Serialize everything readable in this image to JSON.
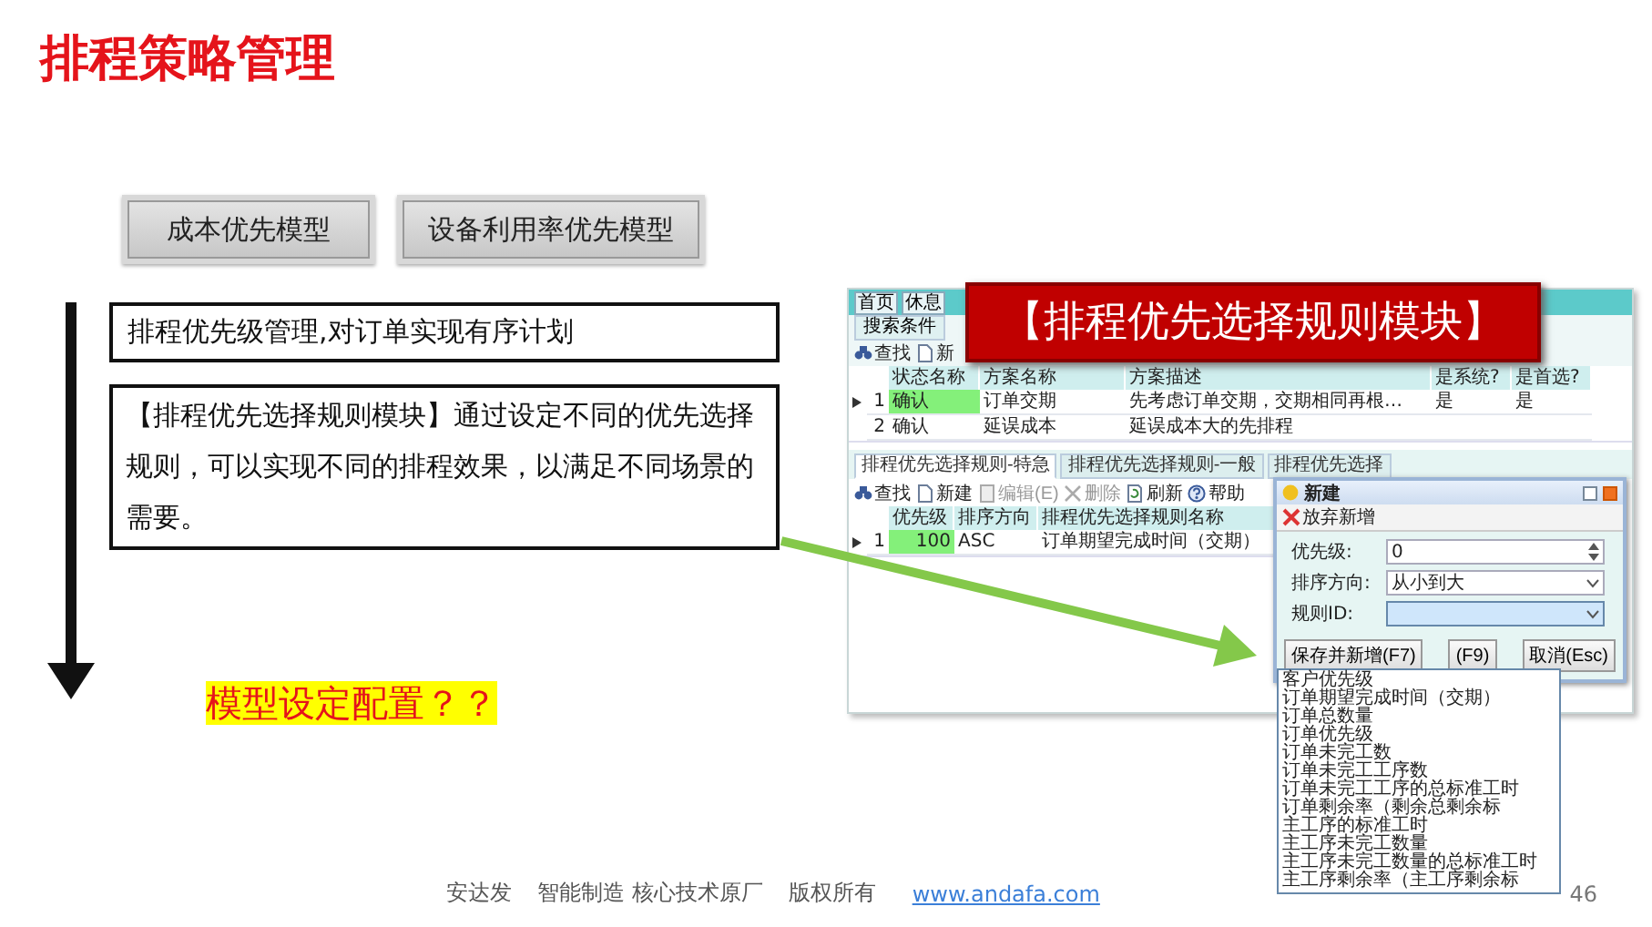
{
  "title": "排程策略管理",
  "model_buttons": [
    {
      "label": "成本优先模型"
    },
    {
      "label": "设备利用率优先模型"
    }
  ],
  "notes": [
    {
      "text": "排程优先级管理,对订单实现有序计划"
    },
    {
      "text": "【排程优先选择规则模块】通过设定不同的优先选择规则，可以实现不同的排程效果，以满足不同场景的需要。"
    }
  ],
  "question": "模型设定配置？？",
  "callout": "【排程优先选择规则模块】",
  "screenshot": {
    "nav_tabs": [
      "首页",
      "休息"
    ],
    "search_tab": "搜索条件",
    "top_toolbar": [
      {
        "kind": "find",
        "label": "查找"
      },
      {
        "kind": "new",
        "label": "新"
      }
    ],
    "plan_table": {
      "columns": [
        "状态名称",
        "方案名称",
        "方案描述",
        "是系统?",
        "是首选?"
      ],
      "rows": [
        {
          "number": "1",
          "current": true,
          "cells": [
            "确认",
            "订单交期",
            "先考虑订单交期，交期相同再根…",
            "是",
            "是"
          ]
        },
        {
          "number": "2",
          "current": false,
          "cells": [
            "确认",
            "延误成本",
            "延误成本大的先排程"
          ]
        }
      ]
    },
    "rule_tabs": [
      {
        "label": "排程优先选择规则-特急",
        "selected": true
      },
      {
        "label": "排程优先选择规则-一般",
        "selected": false
      },
      {
        "label": "排程优先选择",
        "selected": false
      }
    ],
    "rule_toolbar": [
      {
        "kind": "find",
        "label": "查找",
        "disabled": false
      },
      {
        "kind": "new",
        "label": "新建",
        "disabled": false
      },
      {
        "kind": "edit",
        "label": "编辑(E)",
        "disabled": true
      },
      {
        "kind": "delete",
        "label": "删除",
        "disabled": true
      },
      {
        "kind": "refresh",
        "label": "刷新",
        "disabled": false
      },
      {
        "kind": "help",
        "label": "帮助",
        "disabled": false
      }
    ],
    "rule_table": {
      "columns": [
        "优先级",
        "排序方向",
        "排程优先选择规则名称"
      ],
      "rows": [
        {
          "number": "1",
          "current": true,
          "cells": [
            "100",
            "ASC",
            "订单期望完成时间（交期）"
          ]
        }
      ]
    },
    "dialog": {
      "title": "新建",
      "action": "放弃新增",
      "fields": [
        {
          "kind": "spin",
          "label": "优先级:",
          "value": "0",
          "expanded": false
        },
        {
          "kind": "select",
          "label": "排序方向:",
          "value": "从小到大",
          "expanded": false
        },
        {
          "kind": "select",
          "label": "规则ID:",
          "expanded": true,
          "options": [
            "客户优先级",
            "订单期望完成时间（交期）",
            "订单总数量",
            "订单优先级",
            "订单未完工数",
            "订单未完工工序数",
            "订单未完工工序的总标准工时",
            "订单剩余率（剩余总剩余标",
            "主工序的标准工时",
            "主工序未完工数量",
            "主工序未完工数量的总标准工时",
            "主工序剩余率（主工序剩余标"
          ]
        }
      ],
      "buttons": [
        "保存并新增(F7)",
        "(F9)",
        "取消(Esc)"
      ]
    }
  },
  "footer": {
    "company": "安达发",
    "slogan": "智能制造 核心技术原厂",
    "rights": "版权所有",
    "link": "www.andafa.com",
    "page": "46"
  }
}
